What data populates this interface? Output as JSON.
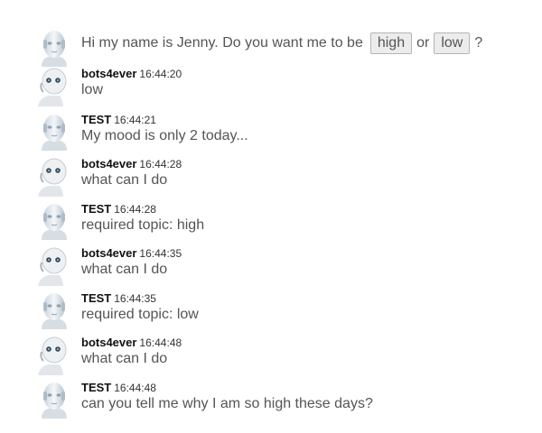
{
  "intro": {
    "text_before": "Hi my name is Jenny. Do you want me to be",
    "option_high": "high",
    "or_word": "or",
    "option_low": "low",
    "text_after": "?"
  },
  "messages": [
    {
      "sender": "bots4ever",
      "time": "16:44:20",
      "text": "low",
      "avatar": "robot-pepper-icon"
    },
    {
      "sender": "TEST",
      "time": "16:44:21",
      "text": "My mood is only 2 today...",
      "avatar": "robot-face-icon"
    },
    {
      "sender": "bots4ever",
      "time": "16:44:28",
      "text": "what can I do",
      "avatar": "robot-pepper-icon"
    },
    {
      "sender": "TEST",
      "time": "16:44:28",
      "text": "required topic: high",
      "avatar": "robot-face-icon"
    },
    {
      "sender": "bots4ever",
      "time": "16:44:35",
      "text": "what can I do",
      "avatar": "robot-pepper-icon"
    },
    {
      "sender": "TEST",
      "time": "16:44:35",
      "text": "required topic: low",
      "avatar": "robot-face-icon"
    },
    {
      "sender": "bots4ever",
      "time": "16:44:48",
      "text": "what can I do",
      "avatar": "robot-pepper-icon"
    },
    {
      "sender": "TEST",
      "time": "16:44:48",
      "text": "can you tell me why I am so high these days?",
      "avatar": "robot-face-icon"
    }
  ]
}
